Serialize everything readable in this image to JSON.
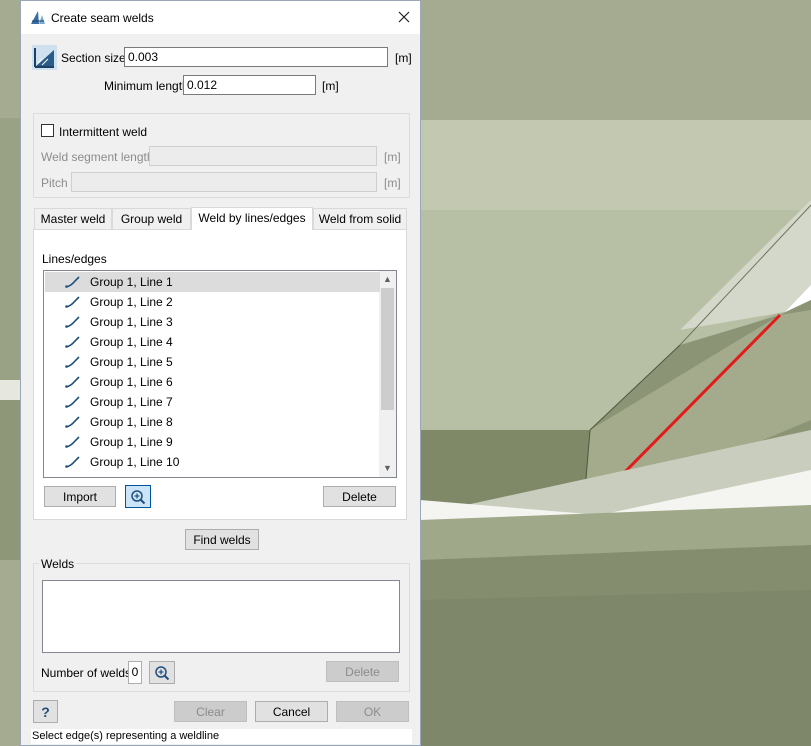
{
  "window": {
    "title": "Create seam welds",
    "close_icon": "close-icon",
    "app_icon": "weld-app-icon"
  },
  "section": {
    "size_label": "Section size",
    "size_value": "0.003",
    "size_unit": "[m]",
    "min_length_label": "Minimum length",
    "min_length_value": "0.012",
    "min_length_unit": "[m]"
  },
  "intermittent": {
    "checkbox_label": "Intermittent weld",
    "checked": false,
    "segment_label": "Weld segment length",
    "segment_unit": "[m]",
    "pitch_label": "Pitch",
    "pitch_unit": "[m]"
  },
  "tabs": [
    {
      "label": "Master weld",
      "active": false
    },
    {
      "label": "Group weld",
      "active": false
    },
    {
      "label": "Weld by lines/edges",
      "active": true
    },
    {
      "label": "Weld from solid",
      "active": false
    }
  ],
  "lines_edges": {
    "label": "Lines/edges",
    "items": [
      "Group 1, Line 1",
      "Group 1, Line 2",
      "Group 1, Line 3",
      "Group 1, Line 4",
      "Group 1, Line 5",
      "Group 1, Line 6",
      "Group 1, Line 7",
      "Group 1, Line 8",
      "Group 1, Line 9",
      "Group 1, Line 10"
    ],
    "selected_index": 0,
    "import_label": "Import",
    "delete_label": "Delete"
  },
  "find_welds_label": "Find welds",
  "welds": {
    "group_label": "Welds",
    "count_label": "Number of welds",
    "count_value": "0",
    "delete_label": "Delete"
  },
  "buttons": {
    "help": "?",
    "clear": "Clear",
    "cancel": "Cancel",
    "ok": "OK"
  },
  "status": "Select edge(s) representing a weldline",
  "colors": {
    "accent": "#0078d7",
    "highlight_edge": "#e21b1b"
  }
}
